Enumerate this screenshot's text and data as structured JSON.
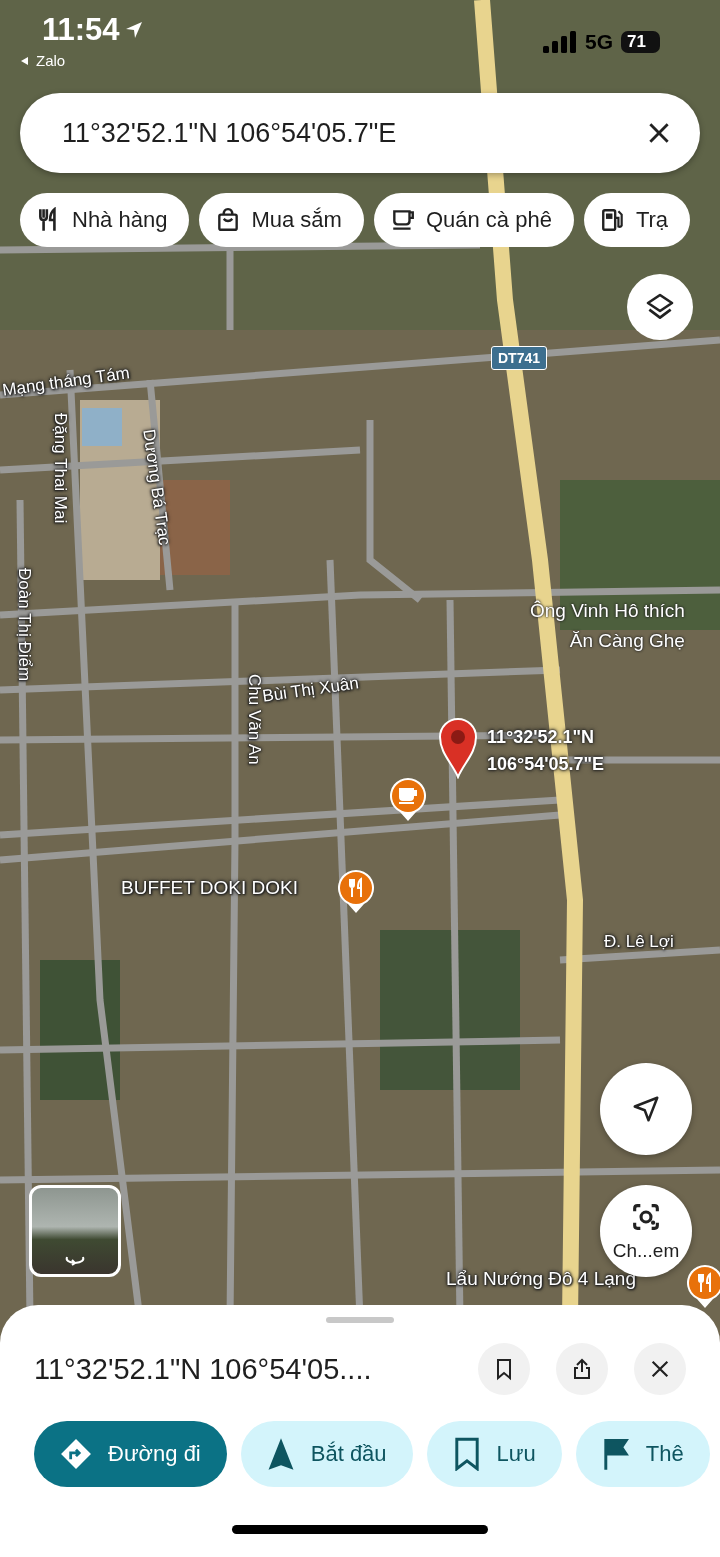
{
  "status_bar": {
    "time": "11:54",
    "back_label": "Zalo",
    "network": "5G",
    "battery": "71"
  },
  "search": {
    "value": "11°32'52.1\"N 106°54'05.7\"E"
  },
  "category_chips": [
    {
      "label": "Nhà hàng",
      "kind": "restaurant"
    },
    {
      "label": "Mua sắm",
      "kind": "shopping"
    },
    {
      "label": "Quán cà phê",
      "kind": "cafe"
    },
    {
      "label": "Trạ",
      "kind": "gas"
    }
  ],
  "map": {
    "road_shield": "DT741",
    "street_labels": [
      "Mạng tháng Tám",
      "Đặng Thai Mai",
      "Dương Bá Trạc",
      "Đoàn Thị Điểm",
      "Chu Văn An",
      "Bùi Thị Xuân",
      "Đ. Lê Lợi"
    ],
    "place_labels": [
      {
        "lines": [
          "Ông Vinh Hô thích",
          "Ăn Càng Ghẹ"
        ]
      }
    ],
    "dropped_pin": {
      "lines": [
        "11°32'52.1\"N",
        "106°54'05.7\"E"
      ]
    },
    "pois": [
      {
        "kind": "cafe"
      },
      {
        "kind": "restaurant",
        "label": "BUFFET DOKI DOKI"
      },
      {
        "kind": "restaurant",
        "label": "Lẩu Nướng Đô 4 Lạng"
      }
    ],
    "camera_button": {
      "label": "Ch...em"
    }
  },
  "place_sheet": {
    "title": "11°32'52.1\"N 106°54'05....",
    "actions": [
      {
        "label": "Đường đi",
        "kind": "directions",
        "primary": true
      },
      {
        "label": "Bắt đầu",
        "kind": "start",
        "primary": false
      },
      {
        "label": "Lưu",
        "kind": "save",
        "primary": false
      },
      {
        "label": "Thê",
        "kind": "flag",
        "primary": false
      }
    ]
  }
}
